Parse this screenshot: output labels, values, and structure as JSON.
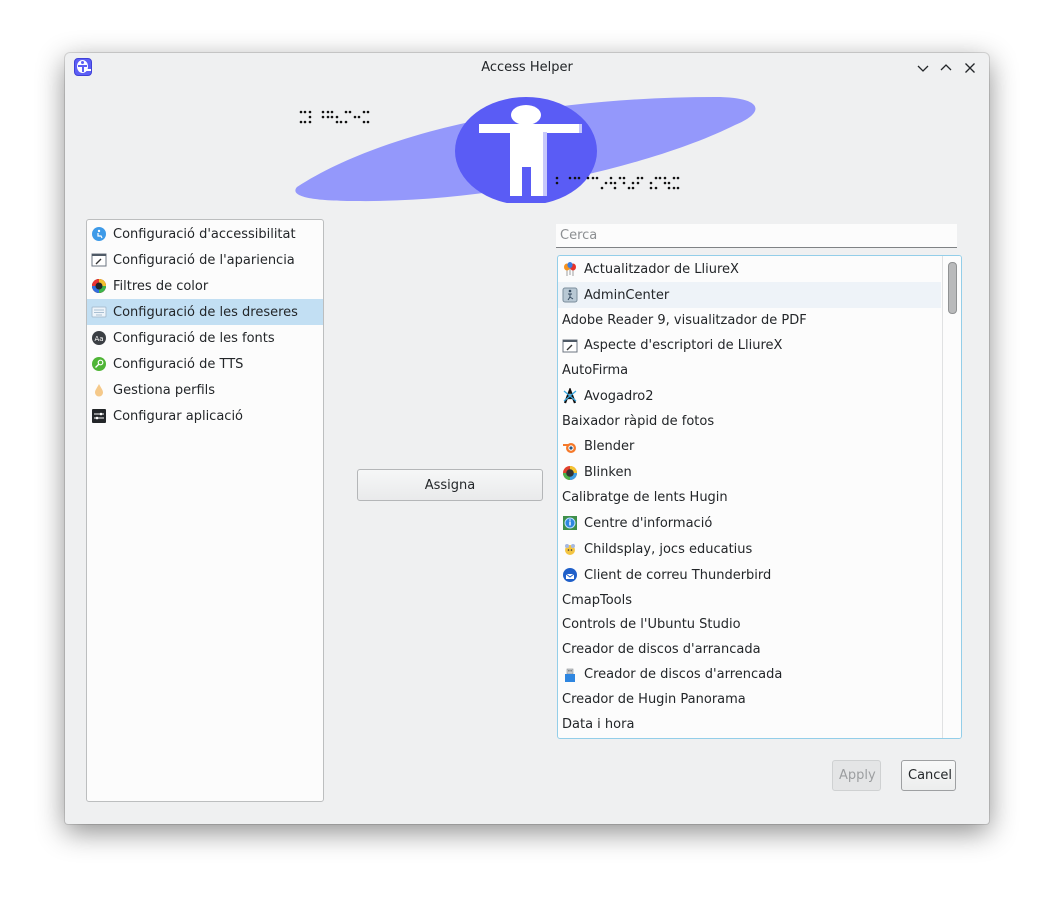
{
  "window": {
    "title": "Access Helper",
    "icon": "access-helper-icon",
    "controls": [
      "minimize",
      "maximize",
      "close"
    ]
  },
  "banner": {
    "description": "Accessibility logo with braille dots",
    "colors": {
      "ellipse": "#9498fb",
      "circle": "#5a5cf5",
      "figure": "#ffffff"
    }
  },
  "sidebar": {
    "selected_index": 3,
    "items": [
      {
        "label": "Configuració d'accessibilitat",
        "icon": "accessibility-icon"
      },
      {
        "label": "Configuració de l'apariencia",
        "icon": "appearance-icon"
      },
      {
        "label": "Filtres de color",
        "icon": "color-filter-icon"
      },
      {
        "label": "Configuració de les dreseres",
        "icon": "keyboard-icon"
      },
      {
        "label": "Configuració de les fonts",
        "icon": "font-icon"
      },
      {
        "label": "Configuració de TTS",
        "icon": "tts-icon"
      },
      {
        "label": "Gestiona perfils",
        "icon": "profile-drop-icon"
      },
      {
        "label": "Configurar aplicació",
        "icon": "settings-sliders-icon"
      }
    ]
  },
  "assign_button": {
    "label": "Assigna"
  },
  "search": {
    "placeholder": "Cerca",
    "value": ""
  },
  "apps": {
    "hovered_index": 1,
    "items": [
      {
        "label": "Actualitzador de LliureX",
        "icon": "balloons-icon"
      },
      {
        "label": "AdminCenter",
        "icon": "admincenter-icon"
      },
      {
        "label": "Adobe Reader 9, visualitzador de PDF",
        "icon": null
      },
      {
        "label": "Aspecte d'escriptori de LliureX",
        "icon": "appearance-icon"
      },
      {
        "label": "AutoFirma",
        "icon": null
      },
      {
        "label": "Avogadro2",
        "icon": "avogadro-icon"
      },
      {
        "label": "Baixador ràpid de fotos",
        "icon": null
      },
      {
        "label": "Blender",
        "icon": "blender-icon"
      },
      {
        "label": "Blinken",
        "icon": "blinken-icon"
      },
      {
        "label": "Calibratge de lents Hugin",
        "icon": null
      },
      {
        "label": "Centre d'informació",
        "icon": "info-center-icon"
      },
      {
        "label": "Childsplay, jocs educatius",
        "icon": "childsplay-icon"
      },
      {
        "label": "Client de correu Thunderbird",
        "icon": "thunderbird-icon"
      },
      {
        "label": "CmapTools",
        "icon": null
      },
      {
        "label": "Controls de l'Ubuntu Studio",
        "icon": null
      },
      {
        "label": "Creador de discos d'arrancada",
        "icon": null
      },
      {
        "label": "Creador de discos d'arrencada",
        "icon": "usb-drive-icon"
      },
      {
        "label": "Creador de Hugin Panorama",
        "icon": null
      },
      {
        "label": "Data i hora",
        "icon": null
      }
    ],
    "scroll_position": 0
  },
  "footer": {
    "apply_label": "Apply",
    "apply_enabled": false,
    "cancel_label": "Cancel"
  }
}
